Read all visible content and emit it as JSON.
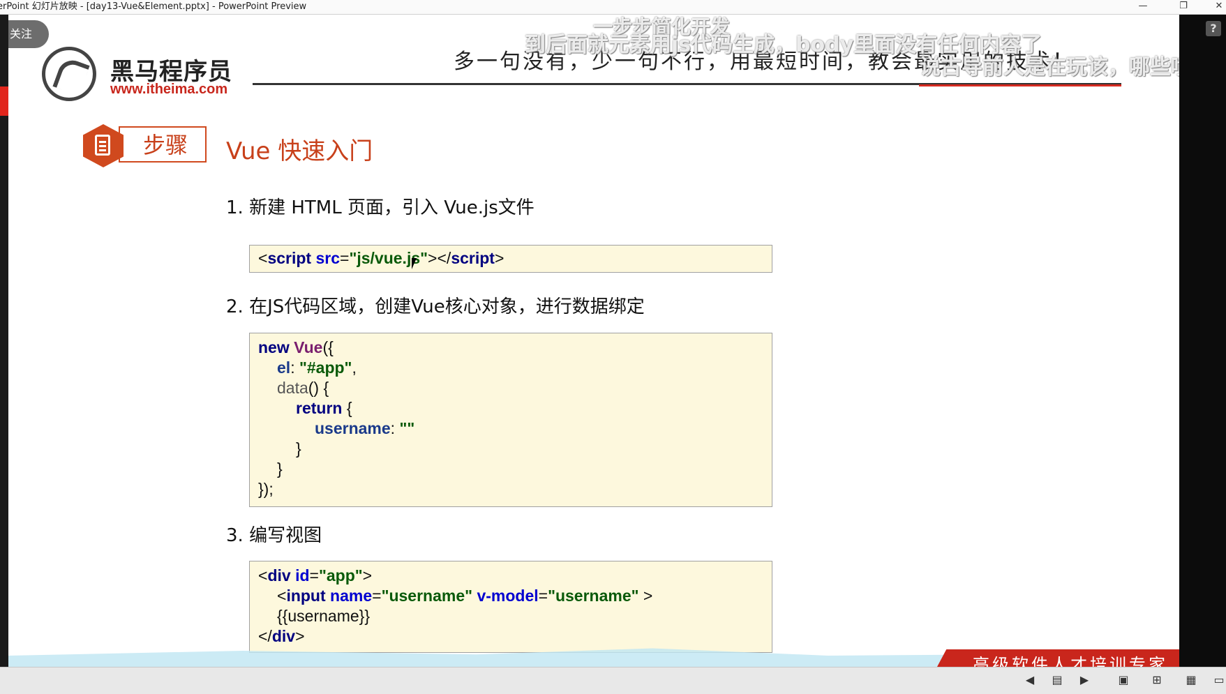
{
  "window": {
    "title": "erPoint 幻灯片放映 - [day13-Vue&Element.pptx] - PowerPoint Preview",
    "minimize": "—",
    "restore": "❐",
    "close": "✕",
    "help": "?"
  },
  "overlay": {
    "follow": "关注",
    "comments": [
      "一步步简化开发",
      "到后面就元素用js代码生成，body里面没有任何内容了",
      "说古导前人是在玩该，哪些喷子"
    ]
  },
  "slide": {
    "logo": {
      "name": "黑马程序员",
      "url": "www.itheima.com"
    },
    "slogan": "多一句没有，少一句不行，用最短时间，教会最实用的技术！",
    "step_label": "步骤",
    "section_title": "Vue 快速入门",
    "steps": [
      {
        "heading": "1. 新建 HTML 页面，引入 Vue.js文件"
      },
      {
        "heading": "2. 在JS代码区域，创建Vue核心对象，进行数据绑定"
      },
      {
        "heading": "3. 编写视图"
      }
    ],
    "code1": {
      "line1": [
        "<",
        "script",
        " ",
        "src",
        "=",
        "\"js/vue.js\"",
        "></",
        "script",
        ">"
      ]
    },
    "code2": {
      "lines": [
        [
          "new",
          " ",
          "Vue",
          "({"
        ],
        [
          "el",
          ": ",
          "\"#app\"",
          ","
        ],
        [
          "data",
          "() {"
        ],
        [
          "return",
          " {"
        ],
        [
          "username",
          ": ",
          "\"\""
        ],
        [
          "}"
        ],
        [
          "}"
        ],
        [
          "});"
        ]
      ]
    },
    "code3": {
      "line1": [
        "<",
        "div",
        " ",
        "id",
        "=",
        "\"app\"",
        ">"
      ],
      "line2": [
        "<",
        "input",
        " ",
        "name",
        "=",
        "\"username\"",
        " ",
        "v-model",
        "=",
        "\"username\"",
        " >"
      ],
      "line3": [
        "{{username}}"
      ],
      "line4": [
        "</",
        "div",
        ">"
      ]
    },
    "ribbon": "高级软件人才培训专家"
  },
  "statusbar": {
    "prev": "◀",
    "notes": "▤",
    "next": "▶",
    "view_normal": "▣",
    "view_sorter": "⊞",
    "view_reading": "▦",
    "view_slideshow": "▭"
  },
  "colors": {
    "accent_red": "#c8401a",
    "brand_red": "#c8271d",
    "code_bg": "#fdf8dd"
  }
}
